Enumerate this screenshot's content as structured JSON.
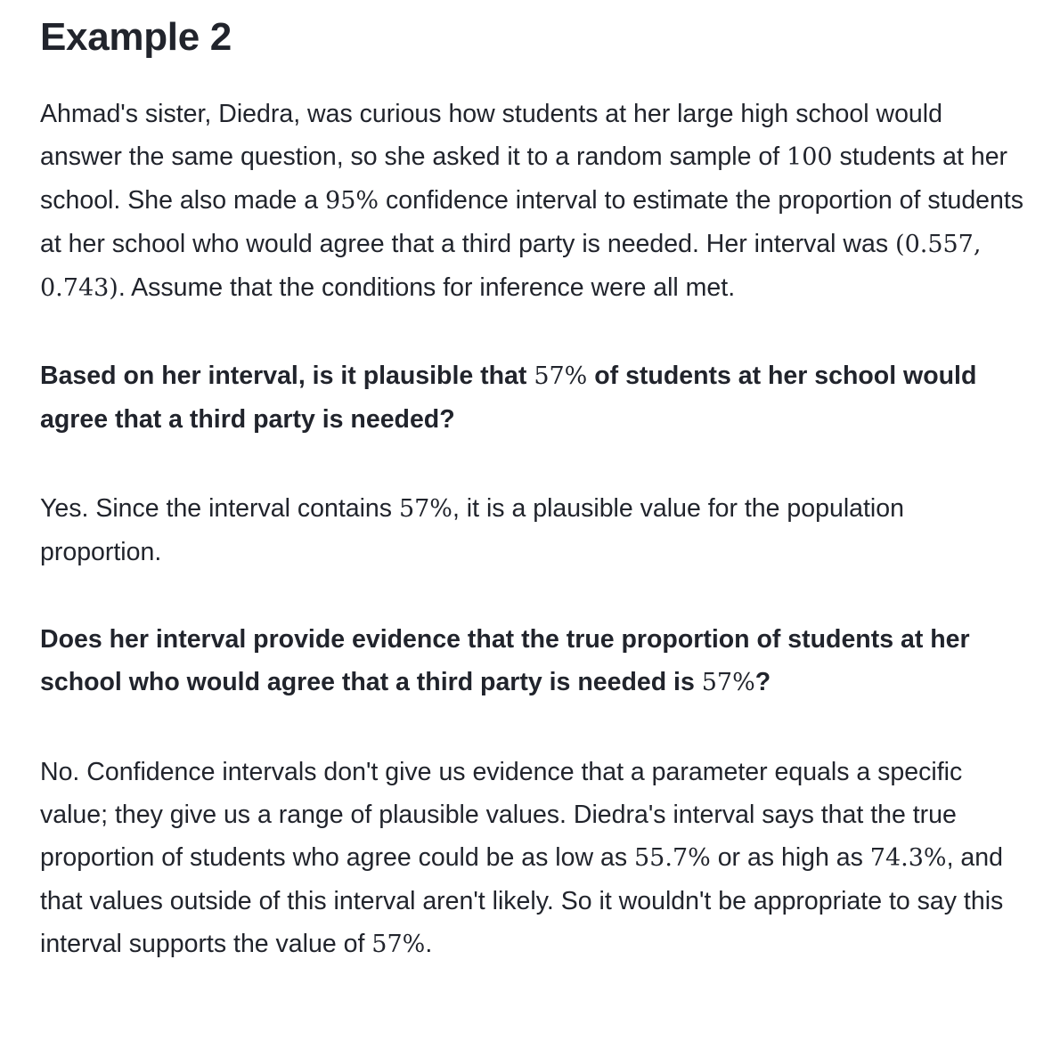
{
  "example": {
    "title": "Example 2",
    "intro": {
      "t1": "Ahmad's sister, Diedra, was curious how students at her large high school would answer the same question, so she asked it to a random sample of ",
      "m1": "100",
      "t2": " students at her school. She also made a ",
      "m2": "95%",
      "t3": " confidence interval to estimate the proportion of students at her school who would agree that a third party is needed. Her interval was ",
      "m3": "(0.557, 0.743)",
      "t4": ". Assume that the conditions for inference were all met."
    },
    "question1": {
      "t1": "Based on her interval, is it plausible that ",
      "m1": "57%",
      "t2": " of students at her school would agree that a third party is needed?"
    },
    "answer1": {
      "t1": "Yes. Since the interval contains ",
      "m1": "57%",
      "t2": ", it is a plausible value for the population proportion."
    },
    "question2": {
      "t1": "Does her interval provide evidence that the true proportion of students at her school who would agree that a third party is needed is ",
      "m1": "57%",
      "t2": "?"
    },
    "answer2": {
      "t1": "No. Confidence intervals don't give us evidence that a parameter equals a specific value; they give us a range of plausible values. Diedra's interval says that the true proportion of students who agree could be as low as ",
      "m1": "55.7%",
      "t2": " or as high as ",
      "m2": "74.3%",
      "t3": ", and that values outside of this interval aren't likely. So it wouldn't be appropriate to say this interval supports the value of ",
      "m3": "57%",
      "t4": "."
    }
  }
}
